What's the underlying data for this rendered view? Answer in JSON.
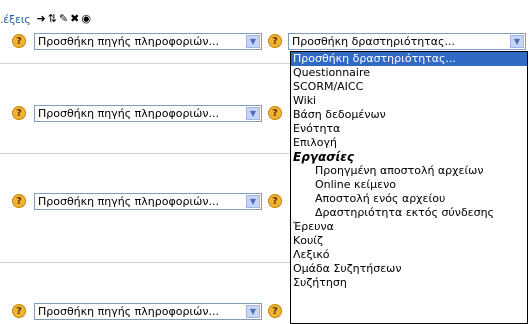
{
  "toolbar": {
    "label": ".έξεις"
  },
  "sections": [
    {
      "resource_select": "Προσθήκη πηγής πληροφοριών...",
      "activity_select": "Προσθήκη δραστηριότητας..."
    },
    {
      "resource_select": "Προσθήκη πηγής πληροφοριών..."
    },
    {
      "resource_select": "Προσθήκη πηγής πληροφοριών..."
    },
    {
      "resource_select": "Προσθήκη πηγής πληροφοριών..."
    }
  ],
  "help_glyph": "?",
  "dropdown": {
    "options": [
      {
        "label": "Προσθήκη δραστηριότητας...",
        "kind": "selected"
      },
      {
        "label": "Questionnaire",
        "kind": "item"
      },
      {
        "label": "SCORM/AICC",
        "kind": "item"
      },
      {
        "label": "Wiki",
        "kind": "item"
      },
      {
        "label": "Βάση δεδομένων",
        "kind": "item"
      },
      {
        "label": "Ενότητα",
        "kind": "item"
      },
      {
        "label": "Επιλογή",
        "kind": "item"
      },
      {
        "label": "Εργασίες",
        "kind": "group"
      },
      {
        "label": "Προηγμένη αποστολή αρχείων",
        "kind": "sub"
      },
      {
        "label": "Online κείμενο",
        "kind": "sub"
      },
      {
        "label": "Αποστολή ενός αρχείου",
        "kind": "sub"
      },
      {
        "label": "Δραστηριότητα εκτός σύνδεσης",
        "kind": "sub"
      },
      {
        "label": "Έρευνα",
        "kind": "item"
      },
      {
        "label": "Κουίζ",
        "kind": "item"
      },
      {
        "label": "Λεξικό",
        "kind": "item"
      },
      {
        "label": "Ομάδα Συζητήσεων",
        "kind": "item"
      },
      {
        "label": "Συζήτηση",
        "kind": "item"
      }
    ]
  }
}
